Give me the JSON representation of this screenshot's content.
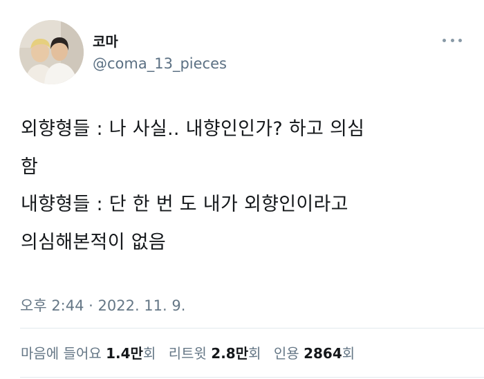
{
  "user": {
    "display_name": "코마",
    "handle": "@coma_13_pieces"
  },
  "tweet": {
    "lines": [
      "외향형들 : 나 사실.. 내향인인가? 하고 의심",
      "함",
      "내향형들 : 단 한 번 도 내가 외향인이라고",
      "의심해본적이 없음"
    ],
    "timestamp": "오후 2:44 · 2022. 11. 9."
  },
  "stats": {
    "likes": {
      "label": "마음에 들어요",
      "count": "1.4만",
      "unit": "회"
    },
    "retweets": {
      "label": "리트윗",
      "count": "2.8만",
      "unit": "회"
    },
    "quotes": {
      "label": "인용",
      "count": "2864",
      "unit": "회"
    }
  },
  "icons": {
    "more": "more-horizontal-icon"
  },
  "colors": {
    "text": "#14171a",
    "secondary": "#657786",
    "divider": "#e1e8ed"
  }
}
